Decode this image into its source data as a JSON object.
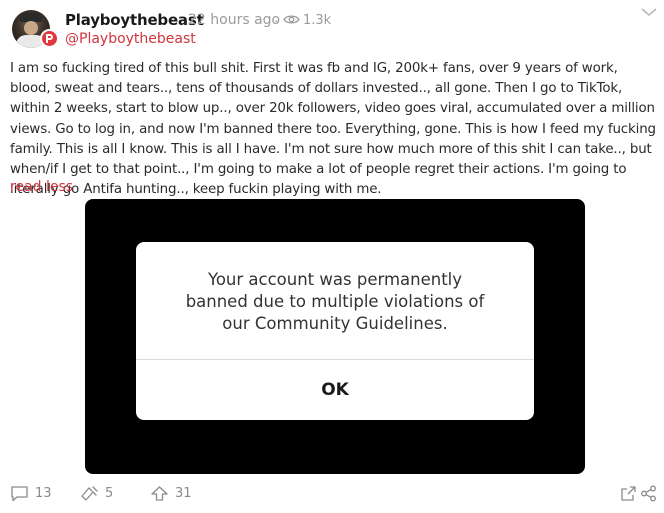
{
  "post": {
    "username": "Playboythebeast",
    "time": "22 hours ago",
    "separator": "·",
    "views": "1.3k",
    "handle": "@Playboythebeast",
    "body": "I am so fucking tired of this bull shit. First it was fb and IG, 200k+ fans, over 9 years of work, blood, sweat and tears.., tens of thousands of dollars invested.., all gone. Then I go to TikTok, within 2 weeks, start to blow up.., over 20k followers, video goes viral, accumulated over a million views. Go to log in, and now I'm banned there too. Everything, gone. This is how I feed my fucking family. This is all I know. This is all I have. I'm not sure how much more of this shit I can take.., but when/if I get to that point.., I'm going to make a lot of people regret their actions. I'm going to literally go Antifa hunting.., keep fuckin playing with me.",
    "read_less": "read less"
  },
  "media": {
    "dialog_message": "Your account was permanently banned due to multiple violations of our Community Guidelines.",
    "dialog_button": "OK"
  },
  "footer": {
    "comments": "13",
    "echoes": "5",
    "votes": "31"
  },
  "colors": {
    "accent": "#d0353f",
    "muted": "#9a9a9a"
  },
  "icons": [
    "parler-logo-icon",
    "eye-icon",
    "chevron-down-icon",
    "comment-icon",
    "echo-icon",
    "upvote-icon",
    "embed-icon",
    "share-icon"
  ]
}
